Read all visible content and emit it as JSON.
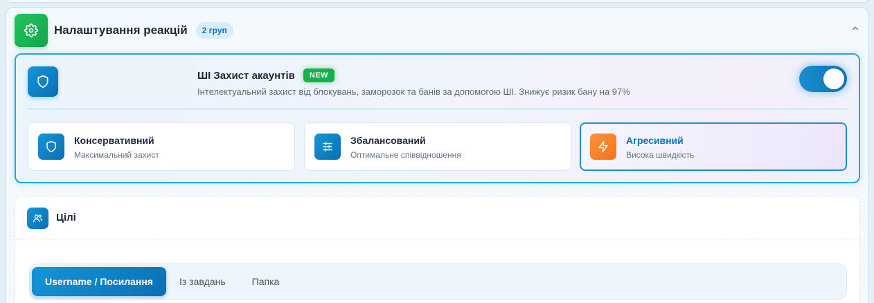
{
  "header": {
    "title": "Налаштування реакцій",
    "badge": "2 груп"
  },
  "ai_protection": {
    "title": "ШІ Захист акаунтів",
    "new_badge": "NEW",
    "description": "Інтелектуальний захист від блокувань, заморозок та банів за допомогою ШІ. Знижує ризик бану на 97%",
    "enabled": true,
    "modes": [
      {
        "name": "Консервативний",
        "subtitle": "Максимальний захист",
        "icon": "shield-icon",
        "selected": false
      },
      {
        "name": "Збалансований",
        "subtitle": "Оптимальне співвідношення",
        "icon": "sliders-icon",
        "selected": false
      },
      {
        "name": "Агресивний",
        "subtitle": "Висока швидкість",
        "icon": "lightning-icon",
        "selected": true
      }
    ]
  },
  "goals": {
    "title": "Цілі",
    "tabs": [
      {
        "label": "Username / Посилання",
        "active": true
      },
      {
        "label": "Із завдань",
        "active": false
      },
      {
        "label": "Папка",
        "active": false
      }
    ]
  },
  "colors": {
    "accent": "#0b74b8",
    "green": "#16a34a",
    "orange": "#f97316"
  }
}
